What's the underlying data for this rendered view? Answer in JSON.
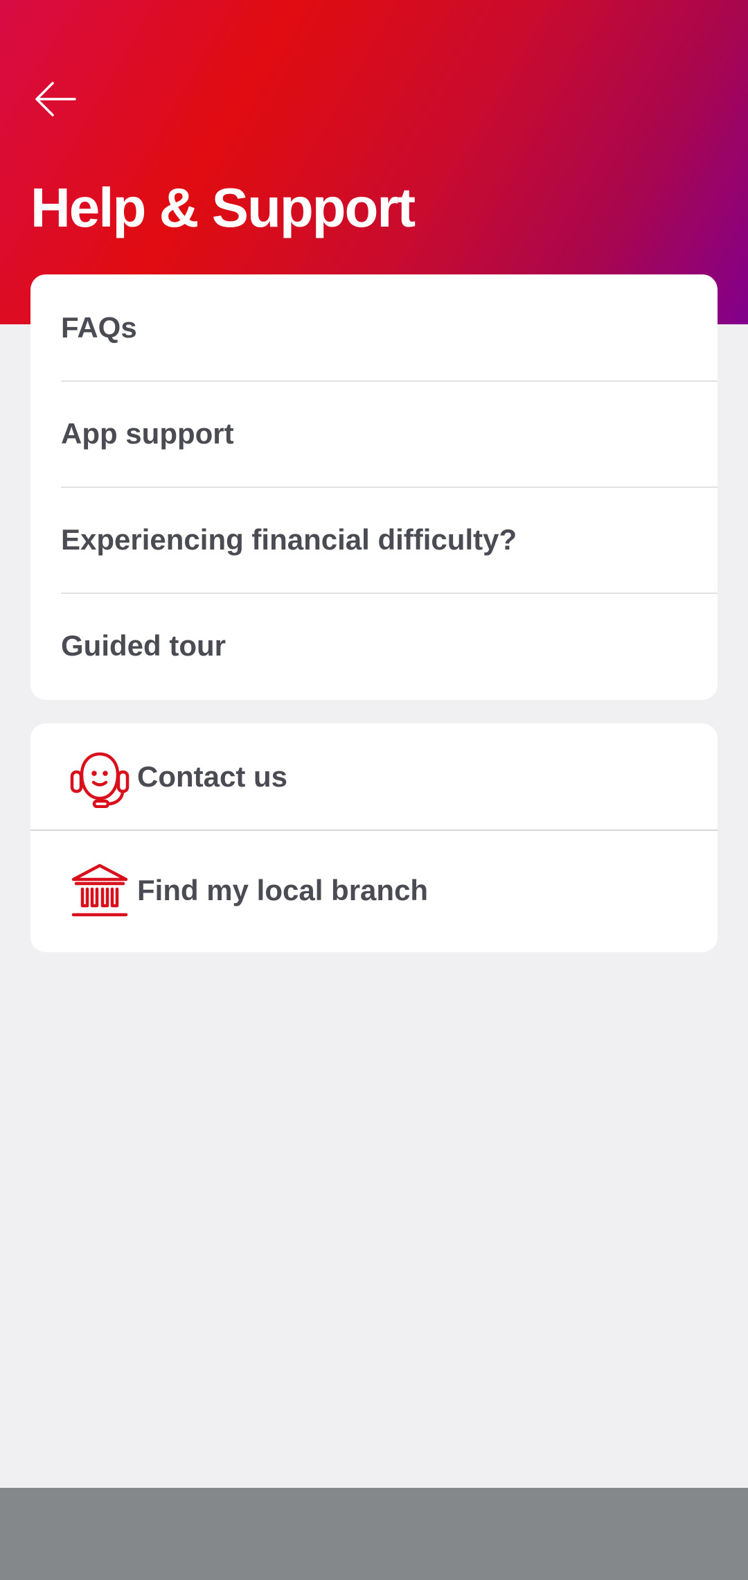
{
  "header": {
    "back_icon": "arrow-left-icon",
    "title": "Help & Support",
    "gradient_colors": [
      "#d80c45",
      "#e00c10",
      "#c90b2e",
      "#a8064f",
      "#82008c"
    ]
  },
  "menu": {
    "items": [
      {
        "label": "FAQs"
      },
      {
        "label": "App support"
      },
      {
        "label": "Experiencing financial difficulty?"
      },
      {
        "label": "Guided tour"
      }
    ]
  },
  "contact": {
    "items": [
      {
        "label": "Contact us",
        "icon": "headset-agent-icon"
      },
      {
        "label": "Find my local branch",
        "icon": "bank-branch-icon"
      }
    ],
    "icon_color": "#d9101c"
  },
  "colors": {
    "background": "#f0f0f2",
    "text": "#4b4c53",
    "bottom_bar": "#85888b"
  }
}
